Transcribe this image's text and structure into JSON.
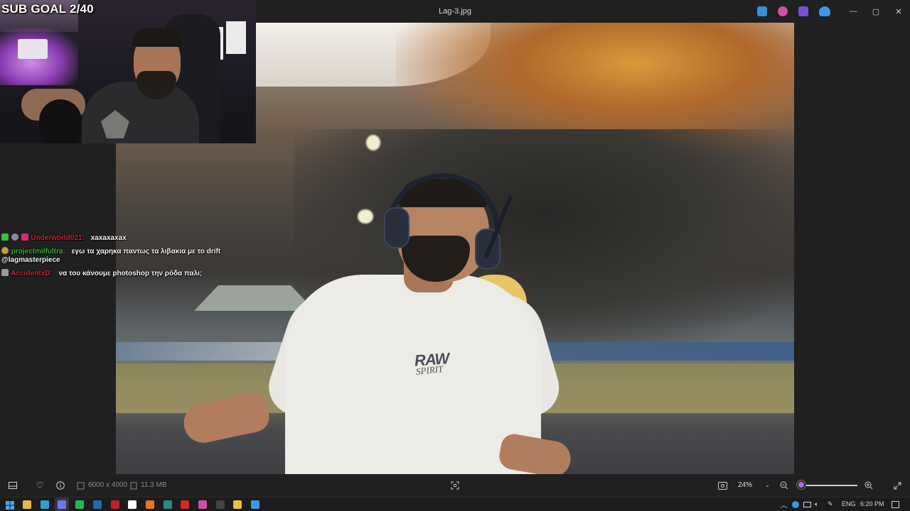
{
  "window": {
    "title": "Lag-3.jpg",
    "controls": {
      "minimize": "—",
      "maximize": "▢",
      "close": "✕"
    }
  },
  "titlebar_apps": [
    {
      "name": "edit-app",
      "color": "#3a8fd8"
    },
    {
      "name": "designer-app",
      "color": "#d04fa8"
    },
    {
      "name": "clipchamp-app",
      "color": "#7a4fd8"
    },
    {
      "name": "onedrive",
      "color": "#3b9ae8"
    }
  ],
  "overlay": {
    "sub_goal": "SUB GOAL 2/40"
  },
  "chat": [
    {
      "badges": [
        "#3cbf3c",
        "#8a8aa8",
        "#d0306a"
      ],
      "user": "Underworld021:",
      "user_color": "#c8233c",
      "message": "xaxaxaxax",
      "mention": ""
    },
    {
      "badges": [
        "#c89a3a"
      ],
      "user": "projectmilfultra:",
      "user_color": "#3aa83a",
      "message": "εγω τα χαρηκα παντως τα λιβακια με το drift",
      "mention": "@lagmasterpiece"
    },
    {
      "badges": [
        "#9a9a9a"
      ],
      "user": "AccidentxD:",
      "user_color": "#c8233c",
      "message": "να του κάνουμε photoshop την ρόδα παλι;",
      "mention": ""
    }
  ],
  "photo": {
    "shirt_brand": "RAW",
    "shirt_brand_sub": "SPIRIT"
  },
  "bottombar": {
    "dimensions": "6000 x 4000",
    "filesize": "11.3 MB",
    "zoom": "24%",
    "zoom_fraction": 0.06,
    "accent": "#b36bd6"
  },
  "taskbar": {
    "apps": [
      {
        "name": "file-explorer",
        "color": "#e6b84a"
      },
      {
        "name": "edge",
        "color": "#2a9fd8"
      },
      {
        "name": "discord",
        "color": "#5865f2"
      },
      {
        "name": "spotify",
        "color": "#1db954"
      },
      {
        "name": "steam",
        "color": "#1b6fa8"
      },
      {
        "name": "app-red",
        "color": "#c0222c"
      },
      {
        "name": "app-anchor",
        "color": "#ffffff"
      },
      {
        "name": "app-orange",
        "color": "#e8742a"
      },
      {
        "name": "app-teal",
        "color": "#2a8a8a"
      },
      {
        "name": "app-red2",
        "color": "#d8262a"
      },
      {
        "name": "app-pink",
        "color": "#d04fa8"
      },
      {
        "name": "app-dark",
        "color": "#444444"
      },
      {
        "name": "chrome",
        "color": "#e8c13a"
      },
      {
        "name": "photos",
        "color": "#3a9ae8"
      }
    ],
    "language": "ENG",
    "time": "6:20 PM"
  }
}
